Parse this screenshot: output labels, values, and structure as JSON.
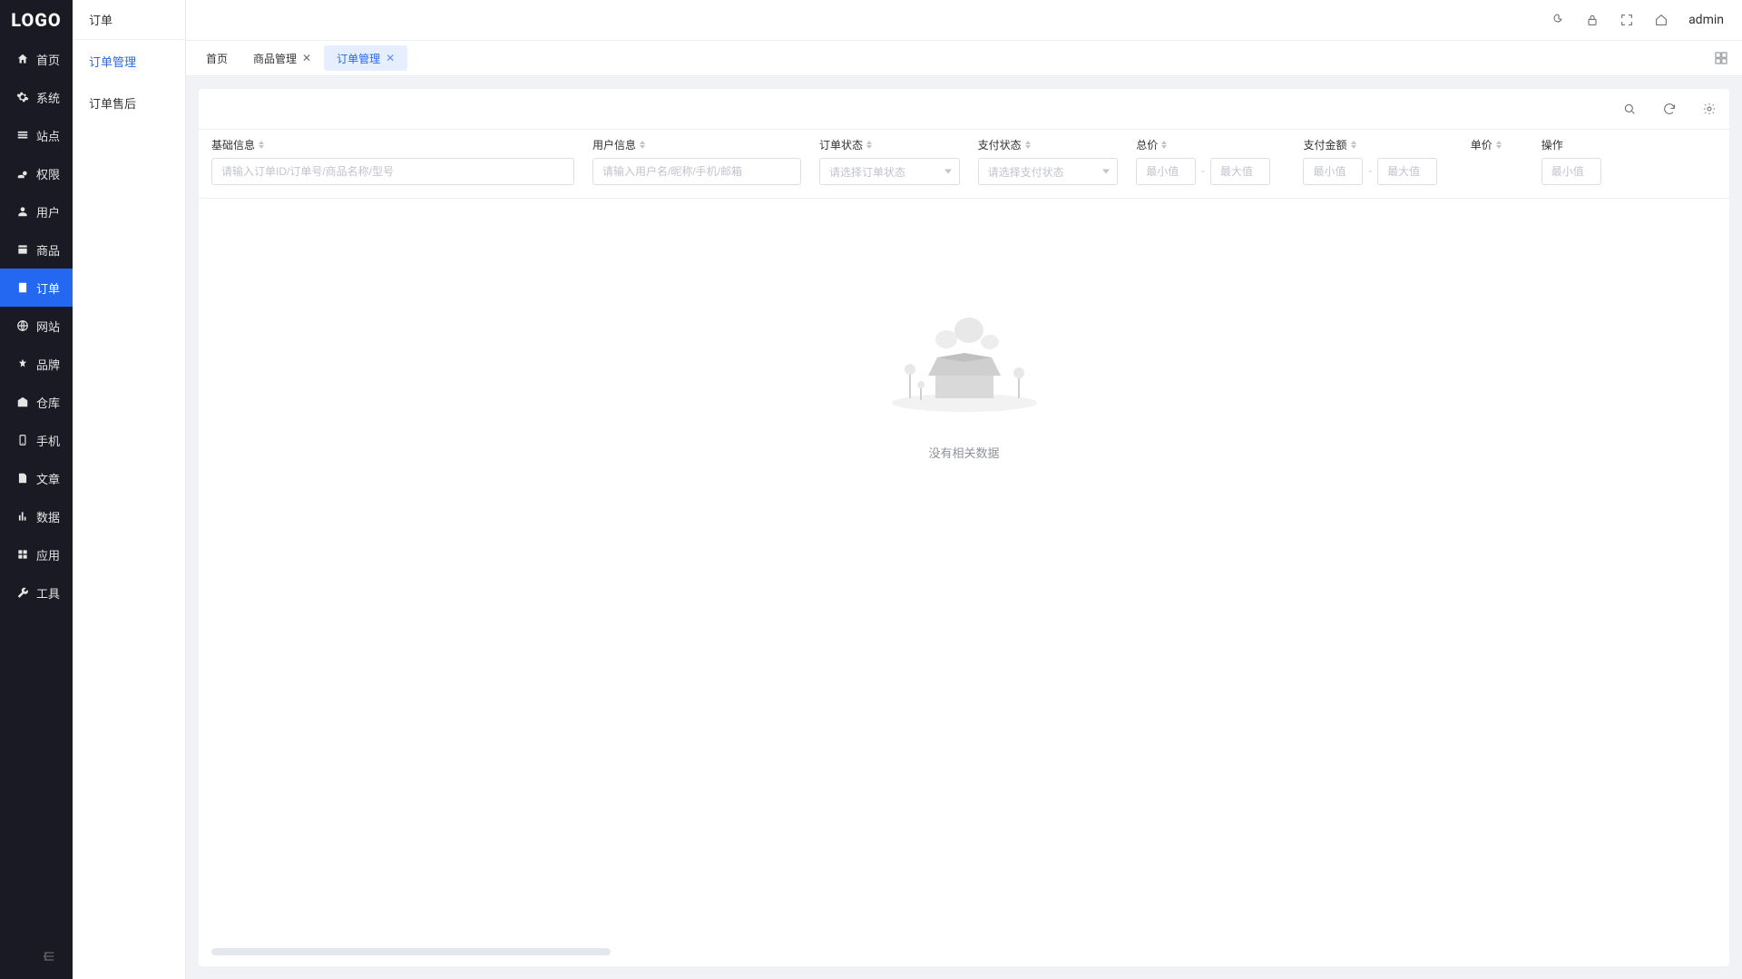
{
  "logo": "LOGO",
  "sidebar": {
    "items": [
      {
        "label": "首页",
        "icon": "home",
        "active": false
      },
      {
        "label": "系统",
        "icon": "gear",
        "active": false
      },
      {
        "label": "站点",
        "icon": "site",
        "active": false
      },
      {
        "label": "权限",
        "icon": "key",
        "active": false
      },
      {
        "label": "用户",
        "icon": "user",
        "active": false
      },
      {
        "label": "商品",
        "icon": "goods",
        "active": false
      },
      {
        "label": "订单",
        "icon": "order",
        "active": true
      },
      {
        "label": "网站",
        "icon": "web",
        "active": false
      },
      {
        "label": "品牌",
        "icon": "brand",
        "active": false
      },
      {
        "label": "仓库",
        "icon": "warehouse",
        "active": false
      },
      {
        "label": "手机",
        "icon": "phone",
        "active": false
      },
      {
        "label": "文章",
        "icon": "article",
        "active": false
      },
      {
        "label": "数据",
        "icon": "chart",
        "active": false
      },
      {
        "label": "应用",
        "icon": "apps",
        "active": false
      },
      {
        "label": "工具",
        "icon": "tool",
        "active": false
      }
    ]
  },
  "subsidebar": {
    "title": "订单",
    "items": [
      {
        "label": "订单管理",
        "active": true
      },
      {
        "label": "订单售后",
        "active": false
      }
    ]
  },
  "header": {
    "user": "admin"
  },
  "tabs": [
    {
      "label": "首页",
      "closable": false,
      "active": false
    },
    {
      "label": "商品管理",
      "closable": true,
      "active": false
    },
    {
      "label": "订单管理",
      "closable": true,
      "active": true
    }
  ],
  "filters": {
    "basic": {
      "label": "基础信息",
      "placeholder": "请输入订单ID/订单号/商品名称/型号"
    },
    "user": {
      "label": "用户信息",
      "placeholder": "请输入用户名/昵称/手机/邮箱"
    },
    "orderStatus": {
      "label": "订单状态",
      "placeholder": "请选择订单状态"
    },
    "payStatus": {
      "label": "支付状态",
      "placeholder": "请选择支付状态"
    },
    "total": {
      "label": "总价",
      "min_placeholder": "最小值",
      "max_placeholder": "最大值"
    },
    "payAmount": {
      "label": "支付金额",
      "min_placeholder": "最小值",
      "max_placeholder": "最大值"
    },
    "price": {
      "label": "单价",
      "min_placeholder": "最小值"
    },
    "operation": {
      "label": "操作"
    }
  },
  "empty": {
    "text": "没有相关数据"
  }
}
